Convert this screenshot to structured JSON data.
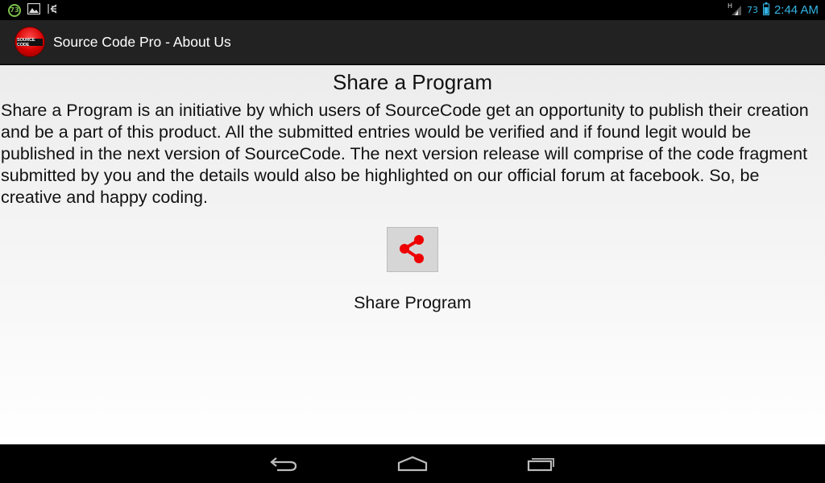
{
  "status_bar": {
    "notification_badge": "73",
    "battery_level": "73",
    "time": "2:44 AM"
  },
  "action_bar": {
    "app_icon_text": "SOURCE CODE",
    "title": "Source Code Pro - About Us"
  },
  "content": {
    "title": "Share a Program",
    "description": "Share a Program is an initiative by which users of SourceCode get an opportunity to publish their creation and be a part of this product. All the submitted entries would be verified and if found legit would be published in the next version of SourceCode. The next version release will comprise of the code fragment submitted by you and the details would also be highlighted on our official forum at facebook. So, be creative and happy coding.",
    "share_label": "Share Program"
  },
  "colors": {
    "status_accent": "#33b5e5",
    "action_bar": "#222222",
    "share_icon": "#ee0000",
    "share_button": "#d6d6d6"
  }
}
